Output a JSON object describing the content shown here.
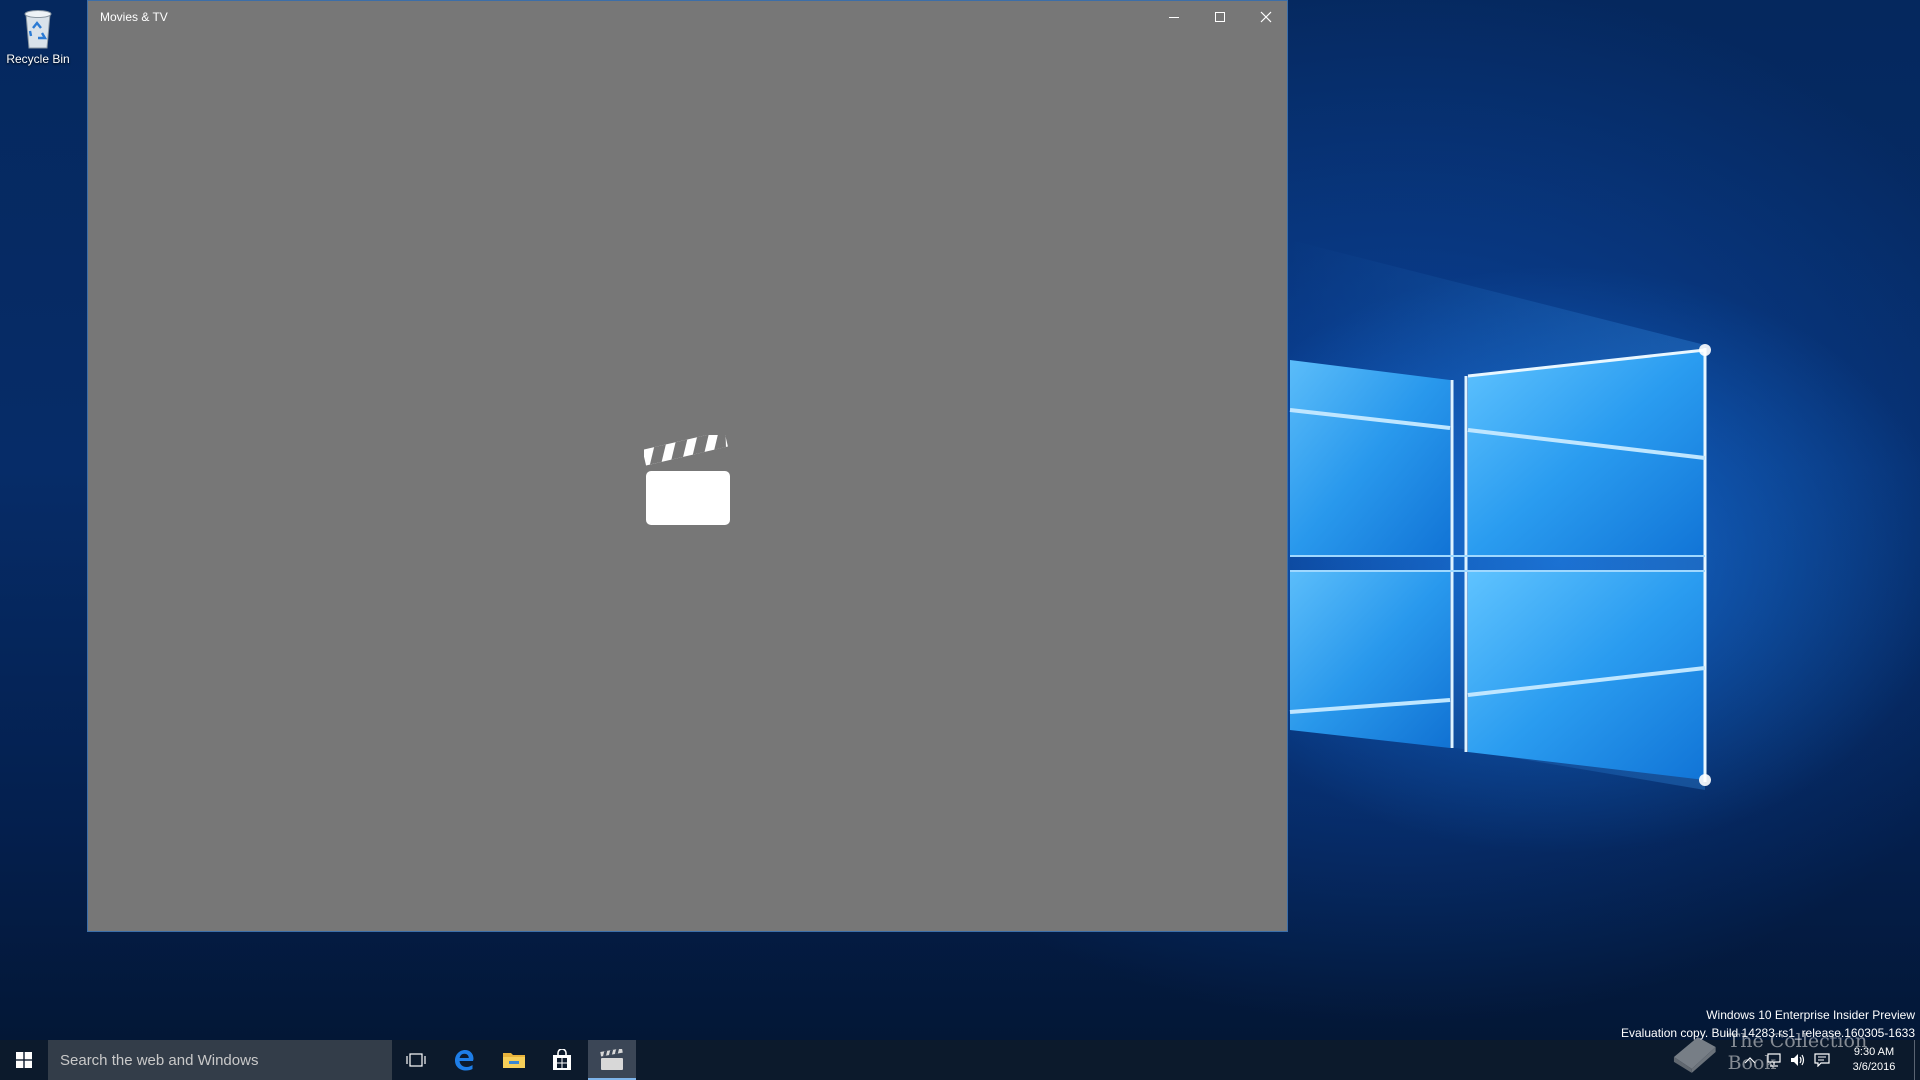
{
  "desktop": {
    "recycle_bin_label": "Recycle Bin",
    "watermark": {
      "line1": "Windows 10 Enterprise Insider Preview",
      "line2": "Evaluation copy. Build 14283.rs1_release.160305-1633"
    },
    "site_watermark": "The Collection Book"
  },
  "window": {
    "title": "Movies & TV",
    "background_color": "#777777",
    "icons": {
      "minimize": "minimize-icon",
      "maximize": "maximize-icon",
      "close": "close-icon",
      "splash": "clapperboard-icon"
    }
  },
  "taskbar": {
    "search_placeholder": "Search the web and Windows",
    "clock": {
      "time": "9:30 AM",
      "date": "3/6/2016"
    },
    "accent_color": "#7eb4ea",
    "icons": [
      "windows-start-icon",
      "task-view-icon",
      "edge-icon",
      "file-explorer-icon",
      "store-icon",
      "movies-tv-icon"
    ],
    "tray_icons": [
      "chevron-up-icon",
      "network-icon",
      "volume-icon",
      "action-center-icon"
    ]
  }
}
